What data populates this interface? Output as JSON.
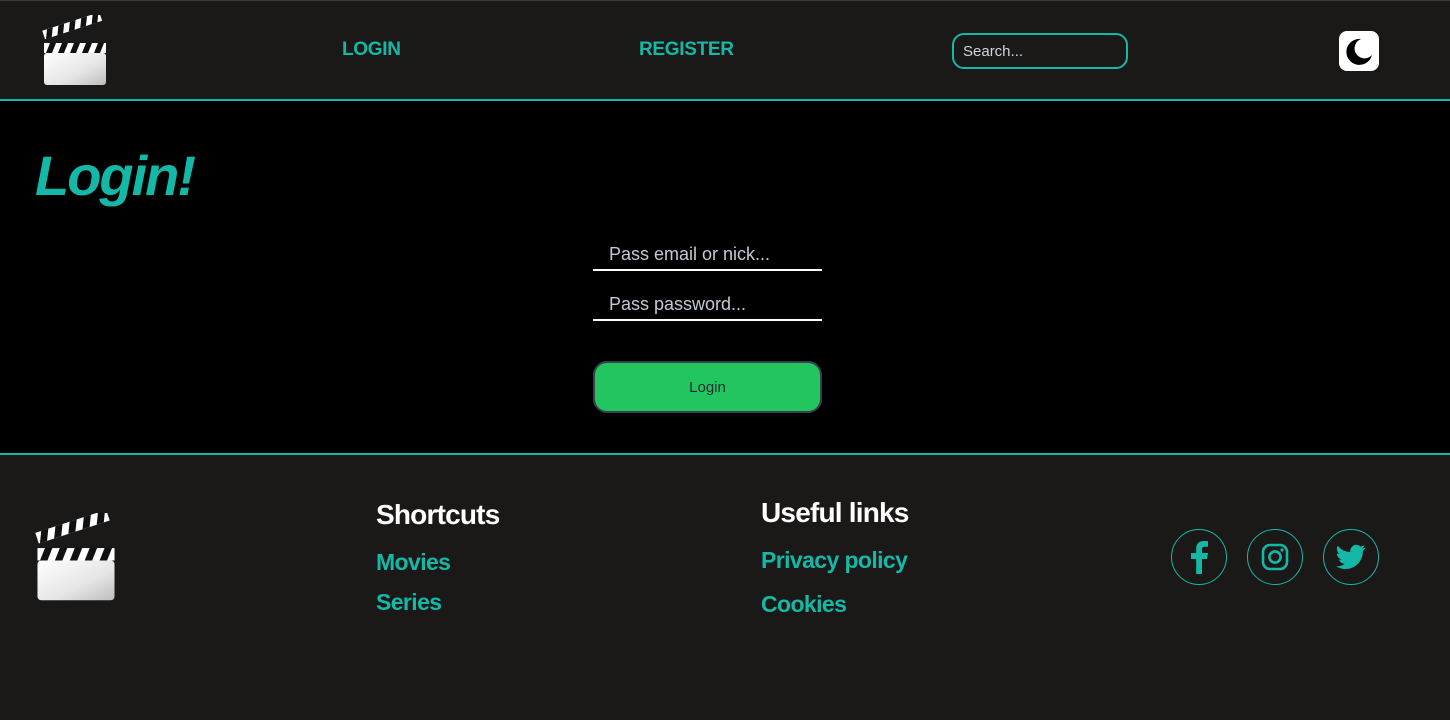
{
  "header": {
    "nav": {
      "login_label": "LOGIN",
      "register_label": "REGISTER"
    },
    "search": {
      "placeholder": "Search..."
    },
    "theme_toggle_icon": "moon-icon",
    "logo_icon": "clapperboard-icon"
  },
  "main": {
    "title": "Login!",
    "email_placeholder": "Pass email or nick...",
    "password_placeholder": "Pass password...",
    "submit_label": "Login"
  },
  "footer": {
    "logo_icon": "clapperboard-icon",
    "shortcuts": {
      "heading": "Shortcuts",
      "links": [
        "Movies",
        "Series"
      ]
    },
    "useful_links": {
      "heading": "Useful links",
      "links": [
        "Privacy policy",
        "Cookies"
      ]
    },
    "social_icons": [
      "facebook-icon",
      "instagram-icon",
      "twitter-icon"
    ]
  },
  "colors": {
    "accent": "#14b8a6",
    "button": "#22c55e",
    "bar_background": "#1a1918",
    "main_background": "#000000"
  }
}
